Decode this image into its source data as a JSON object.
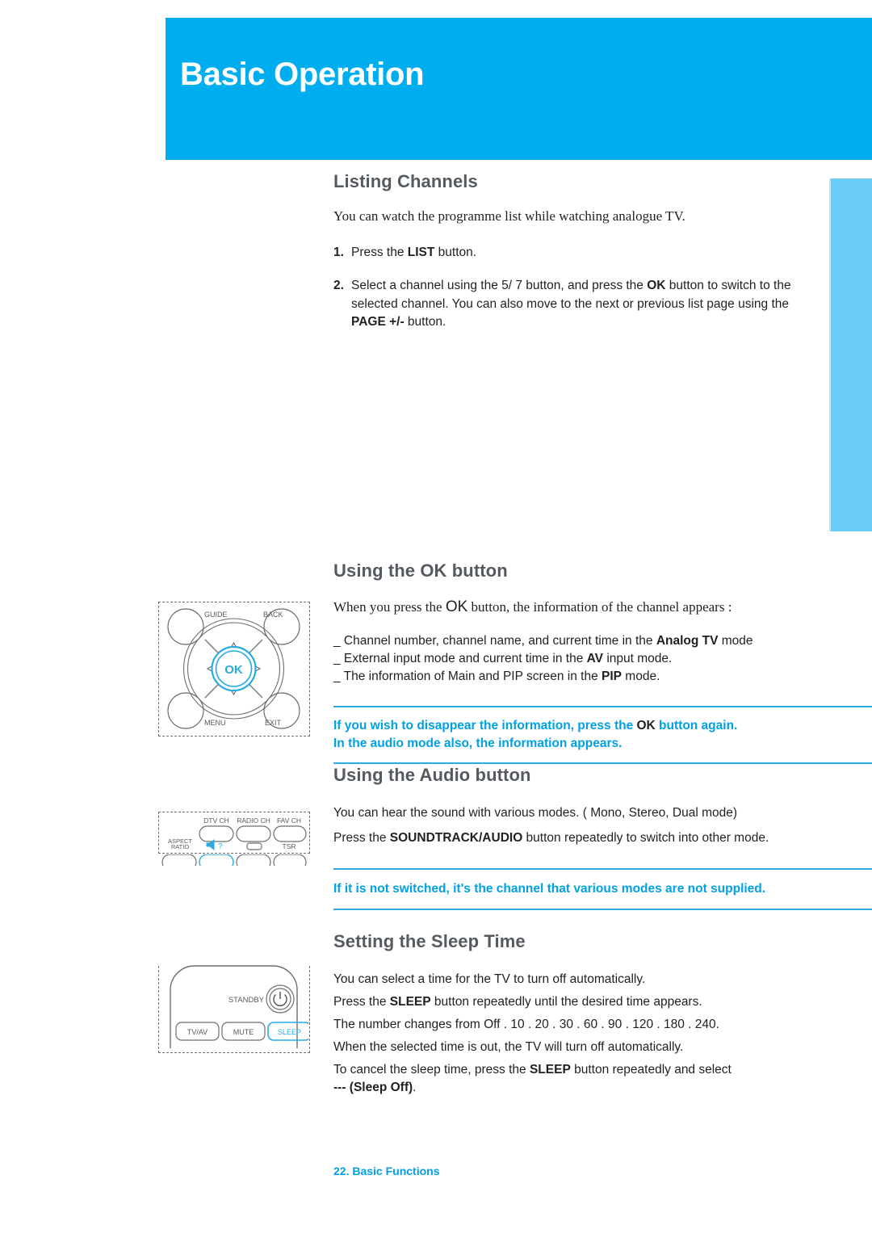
{
  "page": {
    "title": "Basic Operation",
    "footer": "22. Basic Functions",
    "accent_blue": "#00aeef",
    "callout_blue": "#00a0e3",
    "side_tab_blue": "#69cdf7",
    "heading_gray": "#555a60"
  },
  "listing": {
    "heading": "Listing Channels",
    "intro": "You can watch the programme list while watching analogue TV.",
    "steps": [
      {
        "num": "1.",
        "parts": [
          {
            "t": "Press the ",
            "b": false
          },
          {
            "t": "LIST",
            "b": true
          },
          {
            "t": " button.",
            "b": false
          }
        ]
      },
      {
        "num": "2.",
        "parts": [
          {
            "t": "Select a channel using the  5/ 7 button, and press the ",
            "b": false
          },
          {
            "t": "OK",
            "b": true
          },
          {
            "t": " button to switch to the selected channel. You can also move to the next or previous list page using the ",
            "b": false
          },
          {
            "t": "PAGE +/-",
            "b": true
          },
          {
            "t": " button.",
            "b": false
          }
        ]
      }
    ]
  },
  "ok_button": {
    "heading": "Using the OK button",
    "intro_pre": "When you press the ",
    "intro_ok": "OK",
    "intro_post": " button, the information of the channel appears :",
    "bullets": [
      [
        {
          "t": "_ Channel number, channel name, and current time in the ",
          "b": false
        },
        {
          "t": "Analog TV",
          "b": true
        },
        {
          "t": " mode",
          "b": false
        }
      ],
      [
        {
          "t": "_ External input mode and current time in the ",
          "b": false
        },
        {
          "t": "AV",
          "b": true
        },
        {
          "t": " input mode.",
          "b": false
        }
      ],
      [
        {
          "t": "_ The information of Main and PIP screen in the ",
          "b": false
        },
        {
          "t": "PIP",
          "b": true
        },
        {
          "t": " mode.",
          "b": false
        }
      ]
    ],
    "callout": [
      [
        {
          "t": "If you wish to disappear the information, press the ",
          "k": false
        },
        {
          "t": "OK",
          "k": true
        },
        {
          "t": " button again.",
          "k": false
        }
      ],
      [
        {
          "t": "In the audio mode also, the information appears.",
          "k": false
        }
      ]
    ],
    "remote": {
      "labels": {
        "guide": "GUIDE",
        "back": "BACK",
        "menu": "MENU",
        "exit": "EXIT",
        "ok": "OK"
      }
    }
  },
  "audio_button": {
    "heading": "Using the Audio button",
    "lines": [
      [
        {
          "t": "You can hear the sound with various modes. ( Mono, Stereo, Dual mode)",
          "b": false
        }
      ],
      [
        {
          "t": "Press the ",
          "b": false
        },
        {
          "t": "SOUNDTRACK/AUDIO",
          "b": true
        },
        {
          "t": " button repeatedly to switch into other mode.",
          "b": false
        }
      ]
    ],
    "callout": [
      [
        {
          "t": "If it is not switched, it's the channel that various modes are not supplied.",
          "k": false
        }
      ]
    ],
    "remote": {
      "labels": {
        "dtv_ch": "DTV CH",
        "radio_ch": "RADIO CH",
        "fav_ch": "FAV CH",
        "aspect_ratio_1": "ASPECT",
        "aspect_ratio_2": "RATIO",
        "audio": "?",
        "tsr": "TSR"
      }
    }
  },
  "sleep_time": {
    "heading": "Setting the Sleep Time",
    "lines": [
      [
        {
          "t": "You can select a time for the TV to turn off automatically.",
          "b": false
        }
      ],
      [
        {
          "t": "Press the ",
          "b": false
        },
        {
          "t": "SLEEP",
          "b": true
        },
        {
          "t": " button repeatedly until the desired time appears.",
          "b": false
        }
      ],
      [
        {
          "t": "The number changes from Off . 10 . 20 . 30 . 60 . 90 . 120 . 180 . 240.",
          "b": false
        }
      ],
      [
        {
          "t": "When the selected time is out, the TV will turn off automatically.",
          "b": false
        }
      ],
      [
        {
          "t": "To cancel the sleep time, press the ",
          "b": false
        },
        {
          "t": "SLEEP",
          "b": true
        },
        {
          "t": " button repeatedly and select",
          "b": false
        }
      ],
      [
        {
          "t": "--- (Sleep Off)",
          "b": true
        },
        {
          "t": ".",
          "b": false
        }
      ]
    ],
    "remote": {
      "labels": {
        "standby": "STANDBY",
        "tv_av": "TV/AV",
        "mute": "MUTE",
        "sleep": "SLEEP"
      }
    }
  }
}
